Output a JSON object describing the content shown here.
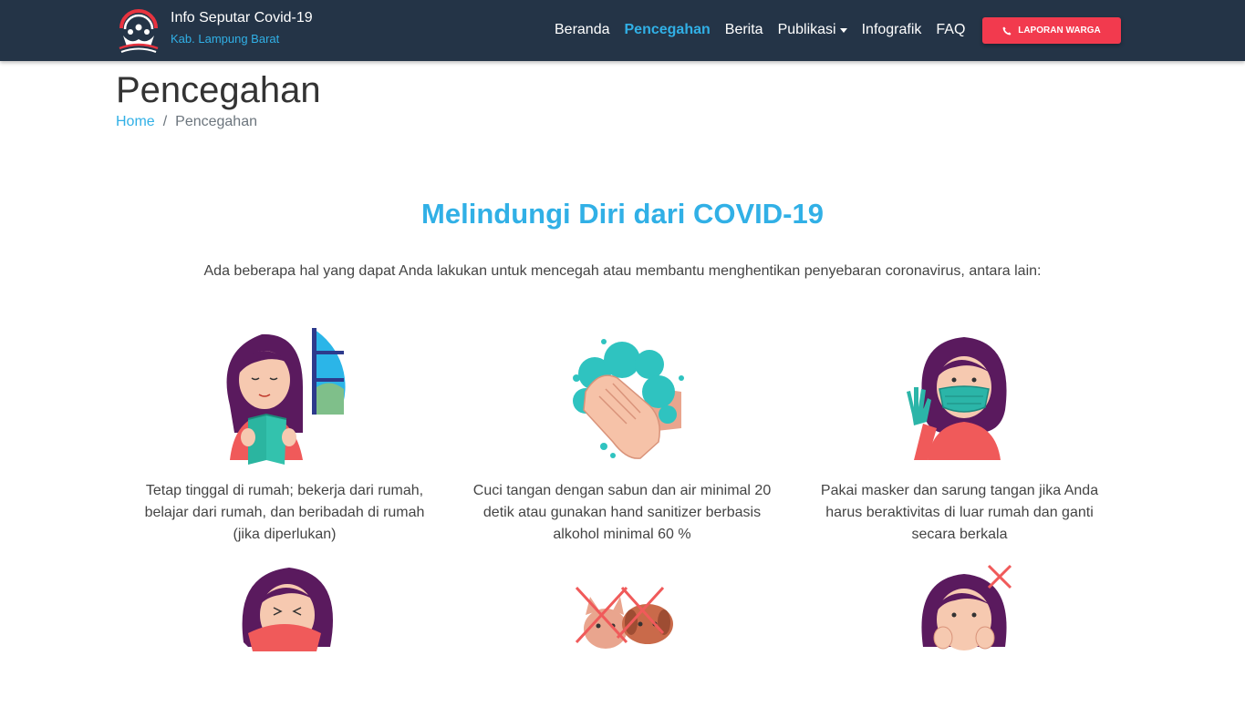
{
  "brand": {
    "title": "Info Seputar Covid-19",
    "subtitle": "Kab. Lampung Barat",
    "logo_icon": "people-circle-logo-icon"
  },
  "nav": {
    "items": [
      {
        "label": "Beranda",
        "active": false
      },
      {
        "label": "Pencegahan",
        "active": true
      },
      {
        "label": "Berita",
        "active": false
      },
      {
        "label": "Publikasi",
        "active": false,
        "dropdown": true
      },
      {
        "label": "Infografik",
        "active": false
      },
      {
        "label": "FAQ",
        "active": false
      }
    ],
    "report_button": "LAPORAN WARGA",
    "report_icon": "phone-icon"
  },
  "page": {
    "title": "Pencegahan",
    "breadcrumb": {
      "home": "Home",
      "separator": "/",
      "current": "Pencegahan"
    }
  },
  "section": {
    "title": "Melindungi Diri dari COVID-19",
    "intro": "Ada beberapa hal yang dapat Anda lakukan untuk mencegah atau membantu menghentikan penyebaran coronavirus, antara lain:"
  },
  "cards": [
    {
      "caption": "Tetap tinggal di rumah; bekerja dari rumah, belajar dari rumah, dan beribadah di rumah (jika diperlukan)",
      "icon": "stay-home-reading-icon"
    },
    {
      "caption": "Cuci tangan dengan sabun dan air minimal 20 detik atau gunakan hand sanitizer berbasis alkohol minimal 60 %",
      "icon": "hand-washing-icon"
    },
    {
      "caption": "Pakai masker dan sarung tangan jika Anda harus beraktivitas di luar rumah dan ganti secara berkala",
      "icon": "mask-and-gloves-icon"
    },
    {
      "caption": "",
      "icon": "sneeze-cover-icon"
    },
    {
      "caption": "",
      "icon": "no-pets-contact-icon"
    },
    {
      "caption": "",
      "icon": "dont-touch-face-icon"
    }
  ],
  "colors": {
    "navbar": "#243447",
    "accent": "#31b0e6",
    "report_button": "#f23a4e"
  }
}
